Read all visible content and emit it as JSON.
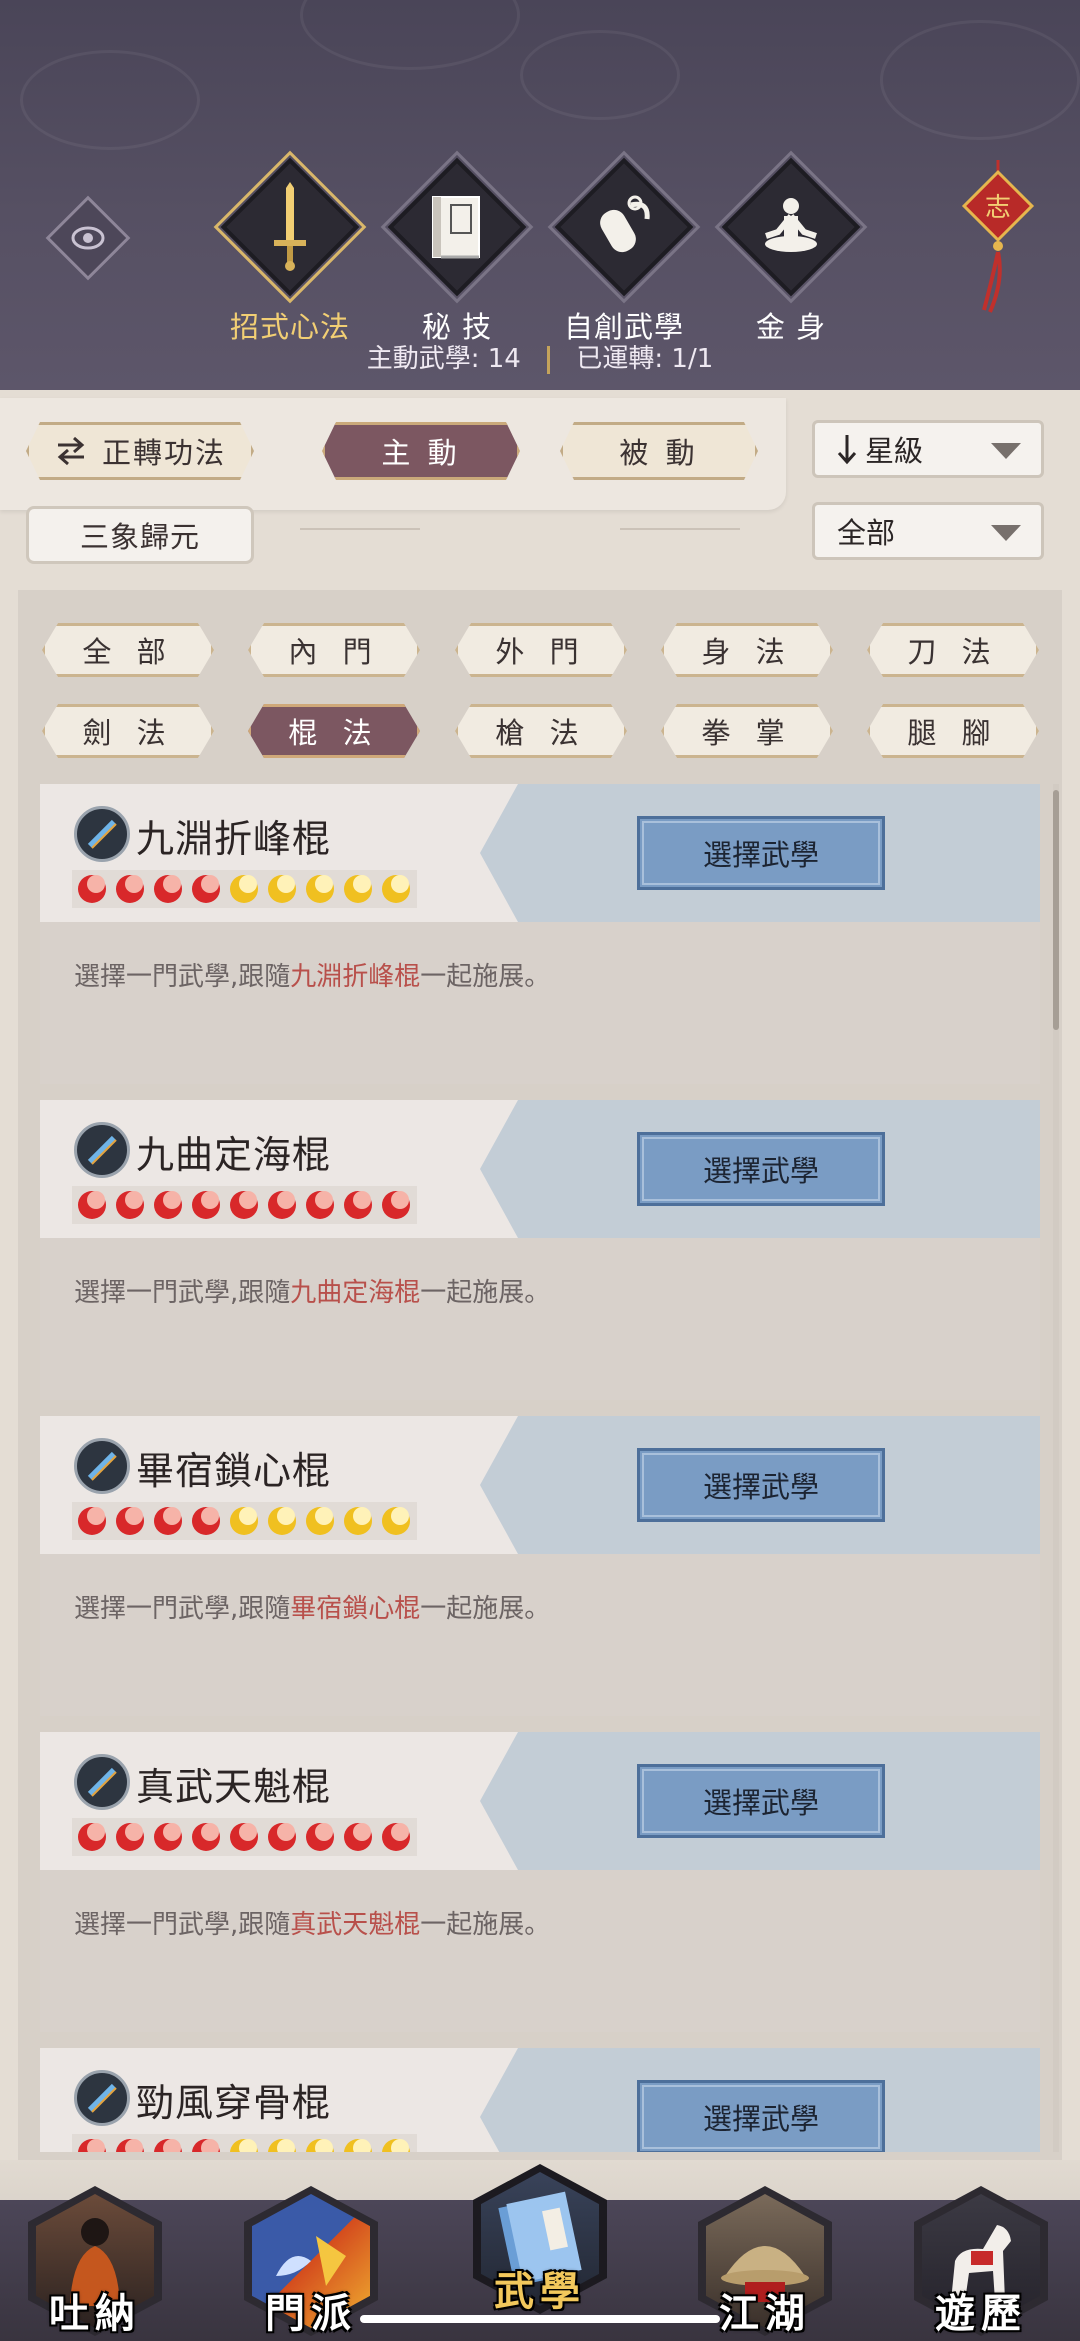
{
  "header": {
    "tabs": [
      {
        "label": "招式心法",
        "icon": "sword-icon",
        "active": true
      },
      {
        "label": "秘 技",
        "icon": "book-icon",
        "active": false
      },
      {
        "label": "自創武學",
        "icon": "scroll-icon",
        "active": false
      },
      {
        "label": "金 身",
        "icon": "meditation-icon",
        "active": false
      }
    ],
    "stats": {
      "active_label": "主動武學:",
      "active_count": "14",
      "running_label": "已運轉:",
      "running_value": "1/1"
    },
    "eye_icon": "eye-icon",
    "knot_icon": "chinese-knot-icon",
    "knot_char": "志"
  },
  "controls": {
    "switch_label": "正轉功法",
    "active_label": "主 動",
    "passive_label": "被 動",
    "sanxiang_label": "三象歸元",
    "sort_select": "星級",
    "filter_select": "全部"
  },
  "filters": {
    "row1": [
      "全 部",
      "內 門",
      "外 門",
      "身 法",
      "刀 法"
    ],
    "row2": [
      "劍 法",
      "棍 法",
      "槍 法",
      "拳 掌",
      "腿 腳"
    ],
    "active": "棍 法"
  },
  "cards": [
    {
      "name": "九淵折峰棍",
      "stars_filled": 4,
      "stars_total": 9,
      "button": "選擇武學",
      "desc_pre": "選擇一門武學,跟隨",
      "desc_hl": "九淵折峰棍",
      "desc_post": "一起施展。"
    },
    {
      "name": "九曲定海棍",
      "stars_filled": 9,
      "stars_total": 9,
      "button": "選擇武學",
      "desc_pre": "選擇一門武學,跟隨",
      "desc_hl": "九曲定海棍",
      "desc_post": "一起施展。"
    },
    {
      "name": "畢宿鎖心棍",
      "stars_filled": 4,
      "stars_total": 9,
      "button": "選擇武學",
      "desc_pre": "選擇一門武學,跟隨",
      "desc_hl": "畢宿鎖心棍",
      "desc_post": "一起施展。"
    },
    {
      "name": "真武天魁棍",
      "stars_filled": 9,
      "stars_total": 9,
      "button": "選擇武學",
      "desc_pre": "選擇一門武學,跟隨",
      "desc_hl": "真武天魁棍",
      "desc_post": "一起施展。"
    },
    {
      "name": "勁風穿骨棍",
      "stars_filled": 4,
      "stars_total": 9,
      "button": "選擇武學",
      "desc_pre": "",
      "desc_hl": "",
      "desc_post": ""
    }
  ],
  "bottom_nav": [
    {
      "label": "吐納",
      "icon": "monk-icon",
      "active": false
    },
    {
      "label": "門派",
      "icon": "sect-flag-icon",
      "active": false
    },
    {
      "label": "武學",
      "icon": "martial-book-icon",
      "active": true
    },
    {
      "label": "江湖",
      "icon": "straw-hat-icon",
      "active": false
    },
    {
      "label": "遊歷",
      "icon": "horse-icon",
      "active": false
    }
  ],
  "colors": {
    "accent_active": "#7c5761",
    "gold": "#f2cf74",
    "button_blue": "#7a9cc4",
    "highlight_red": "#b8504b",
    "star_red": "#d8282a",
    "star_gold": "#f0c020"
  }
}
